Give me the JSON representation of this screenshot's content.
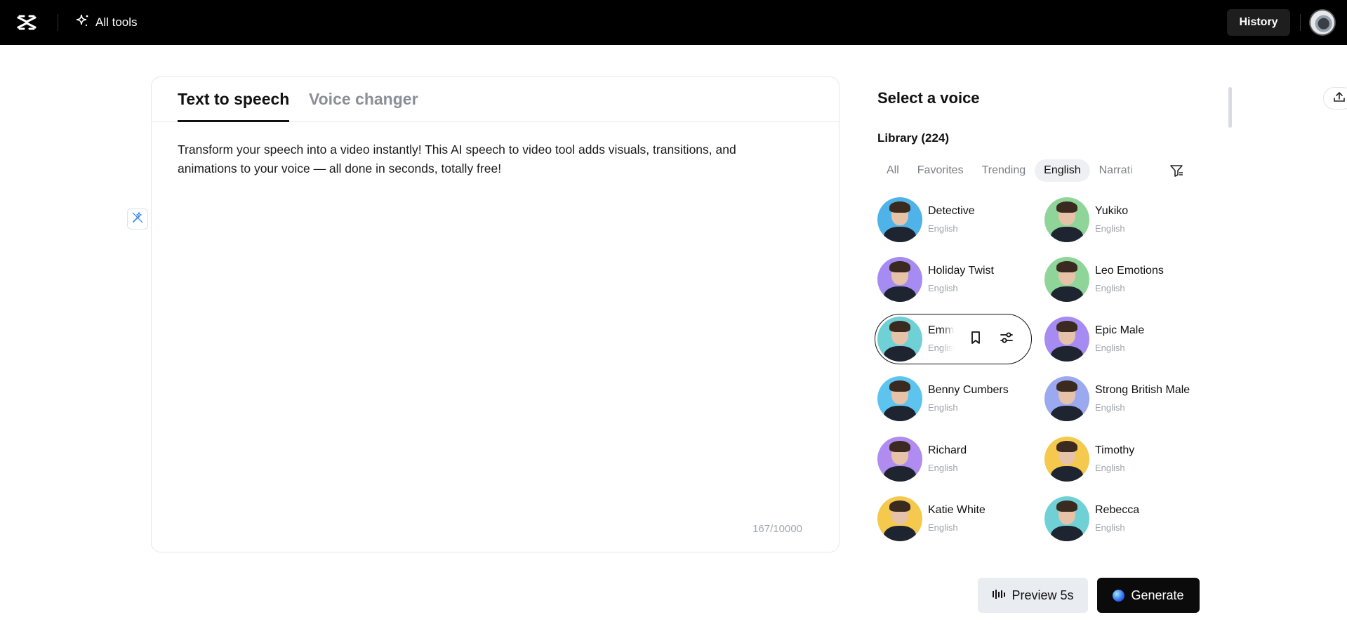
{
  "header": {
    "all_tools_label": "All tools",
    "history_label": "History"
  },
  "editor": {
    "tabs": [
      {
        "label": "Text to speech",
        "active": true
      },
      {
        "label": "Voice changer",
        "active": false
      }
    ],
    "text": "Transform your speech into a video instantly! This AI speech to video tool adds visuals, transitions, and animations to your voice — all done in seconds, totally free!",
    "char_count": "167/10000"
  },
  "voice_panel": {
    "title": "Select a voice",
    "library_label": "Library (224)",
    "filters": [
      {
        "label": "All",
        "active": false
      },
      {
        "label": "Favorites",
        "active": false
      },
      {
        "label": "Trending",
        "active": false
      },
      {
        "label": "English",
        "active": true
      },
      {
        "label": "Narrati",
        "active": false
      }
    ],
    "voices": [
      {
        "name": "Detective",
        "lang": "English",
        "bg": "#4fb3ea"
      },
      {
        "name": "Yukiko",
        "lang": "English",
        "bg": "#8fd59a"
      },
      {
        "name": "Holiday Twist",
        "lang": "English",
        "bg": "#a68cf2"
      },
      {
        "name": "Leo Emotions",
        "lang": "English",
        "bg": "#8fd59a"
      },
      {
        "name": "Emma",
        "lang": "English",
        "bg": "#6fd0d6",
        "selected": true
      },
      {
        "name": "Epic Male",
        "lang": "English",
        "bg": "#a68cf2"
      },
      {
        "name": "Benny Cumbers",
        "lang": "English",
        "bg": "#5cc4ef"
      },
      {
        "name": "Strong British Male",
        "lang": "English",
        "bg": "#9aa9f0"
      },
      {
        "name": "Richard",
        "lang": "English",
        "bg": "#b08cf0"
      },
      {
        "name": "Timothy",
        "lang": "English",
        "bg": "#f5c84e"
      },
      {
        "name": "Katie White",
        "lang": "English",
        "bg": "#f5c84e"
      },
      {
        "name": "Rebecca",
        "lang": "English",
        "bg": "#6fd0d6"
      }
    ]
  },
  "actions": {
    "preview_label": "Preview 5s",
    "generate_label": "Generate"
  }
}
